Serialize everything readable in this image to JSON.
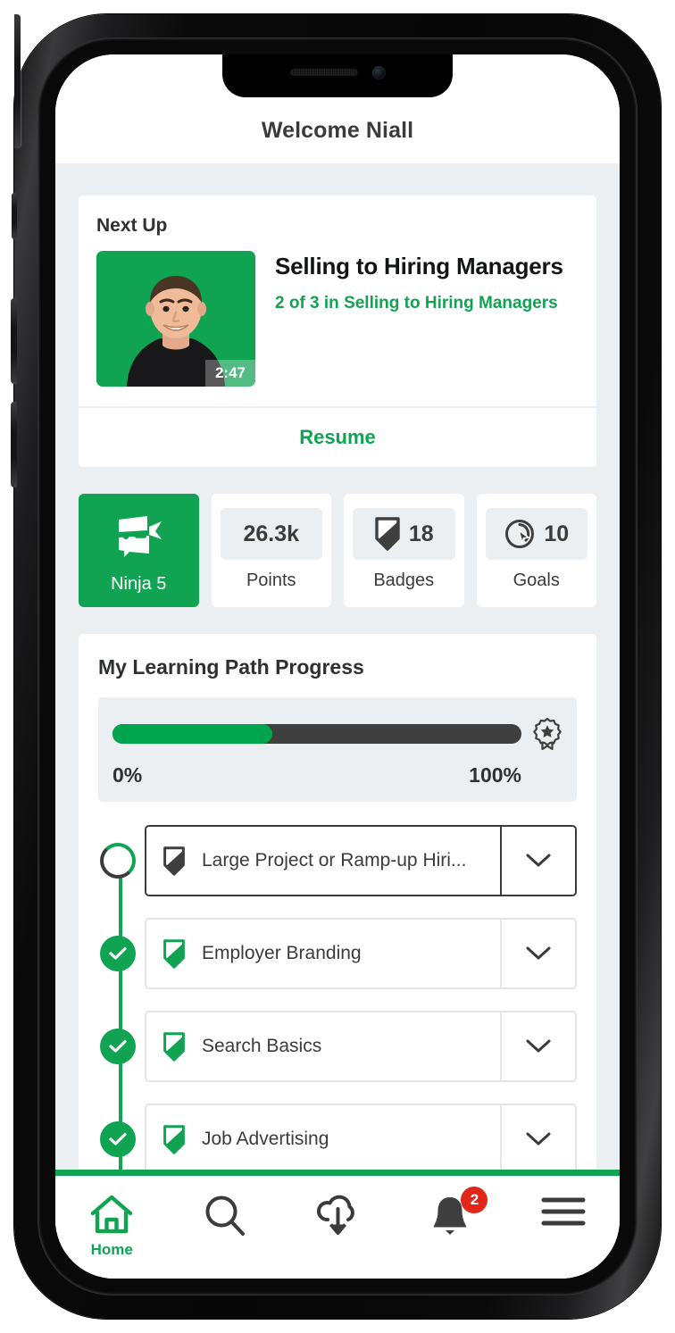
{
  "device": {
    "notch_speaker": "speaker-grille",
    "notch_camera": "front-camera"
  },
  "header": {
    "title": "Welcome Niall"
  },
  "next_up": {
    "section_label": "Next Up",
    "lesson_title": "Selling to Hiring Managers",
    "lesson_subtitle": "2 of 3 in Selling to Hiring Managers",
    "duration": "2:47",
    "resume_label": "Resume",
    "thumbnail_bg": "#10a352"
  },
  "stats": [
    {
      "id": "ninja",
      "value": "",
      "label": "Ninja 5",
      "icon": "ninja-icon",
      "active": true
    },
    {
      "id": "points",
      "value": "26.3k",
      "label": "Points",
      "icon": "",
      "active": false
    },
    {
      "id": "badges",
      "value": "18",
      "label": "Badges",
      "icon": "badge-icon",
      "active": false
    },
    {
      "id": "goals",
      "value": "10",
      "label": "Goals",
      "icon": "target-icon",
      "active": false
    }
  ],
  "learning_path": {
    "title": "My Learning Path Progress",
    "progress_percent": 39,
    "scale_min": "0%",
    "scale_max": "100%",
    "award_icon": "award-ribbon-icon",
    "items": [
      {
        "label": "Large Project or Ramp-up Hiri...",
        "status": "current",
        "icon": "badge-icon-gray",
        "chevron": "chevron-down-icon"
      },
      {
        "label": "Employer Branding",
        "status": "completed",
        "icon": "badge-icon-green",
        "chevron": "chevron-down-icon"
      },
      {
        "label": "Search Basics",
        "status": "completed",
        "icon": "badge-icon-green",
        "chevron": "chevron-down-icon"
      },
      {
        "label": "Job Advertising",
        "status": "completed",
        "icon": "badge-icon-green",
        "chevron": "chevron-down-icon"
      }
    ]
  },
  "bottom_nav": {
    "items": [
      {
        "id": "home",
        "icon": "home-icon",
        "label": "Home",
        "active": true,
        "badge": ""
      },
      {
        "id": "search",
        "icon": "search-icon",
        "label": "",
        "active": false,
        "badge": ""
      },
      {
        "id": "download",
        "icon": "cloud-download-icon",
        "label": "",
        "active": false,
        "badge": ""
      },
      {
        "id": "alerts",
        "icon": "bell-icon",
        "label": "",
        "active": false,
        "badge": "2"
      },
      {
        "id": "menu",
        "icon": "hamburger-menu-icon",
        "label": "",
        "active": false,
        "badge": ""
      }
    ]
  },
  "colors": {
    "brand_green": "#10a352",
    "progress_green": "#00a550",
    "badge_red": "#e3261a",
    "screen_bg": "#eceff1",
    "text_dark": "#3b3b3b"
  }
}
